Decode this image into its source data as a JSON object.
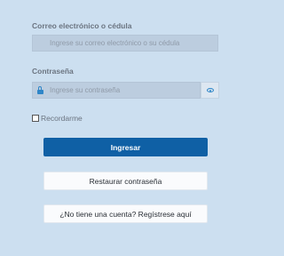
{
  "email": {
    "label": "Correo electrónico o cédula",
    "placeholder": "Ingrese su correo electrónico o su cédula"
  },
  "password": {
    "label": "Contraseña",
    "placeholder": "Ingrese su contraseña",
    "icon": "lock-icon",
    "toggle_icon": "eye-icon"
  },
  "remember": {
    "label": "Recordarme",
    "checked": false
  },
  "buttons": {
    "login": "Ingresar",
    "restore": "Restaurar contraseña",
    "register": "¿No tiene una cuenta? Regístrese aquí"
  },
  "colors": {
    "background": "#ccdff0",
    "primary": "#0f60a5",
    "icon_accent": "#2f86c8"
  }
}
